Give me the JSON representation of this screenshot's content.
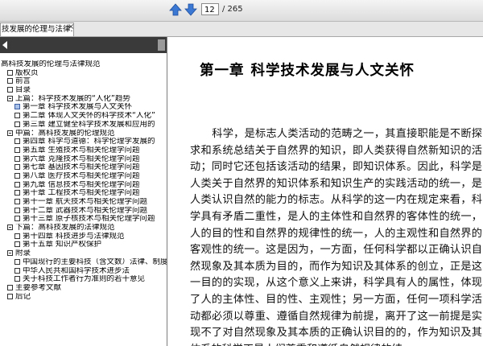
{
  "toolbar": {
    "page_current": "12",
    "page_total": "/ 265"
  },
  "tab": {
    "label": "技发展的伦理与法律...",
    "close": "×"
  },
  "sidebar": {
    "items": [
      {
        "label": "高科技发展的伦理与法律规范",
        "level": 0,
        "box": "none"
      },
      {
        "label": "版权页",
        "level": 1,
        "box": "plain"
      },
      {
        "label": "前言",
        "level": 1,
        "box": "plain"
      },
      {
        "label": "目录",
        "level": 1,
        "box": "plain"
      },
      {
        "label": "上篇：科学技术发展的“人化”趋势",
        "level": 1,
        "box": "plus"
      },
      {
        "label": "第一章  科学技术发展与人文关怀",
        "level": 2,
        "box": "sel"
      },
      {
        "label": "第二章  体现人文关怀的科学技术“人化”",
        "level": 2,
        "box": "plain"
      },
      {
        "label": "第三章  建立健全科学技术发展和应用的",
        "level": 2,
        "box": "plain"
      },
      {
        "label": "中篇：高科技发展的伦理规范",
        "level": 1,
        "box": "plus"
      },
      {
        "label": "第四章  科学与道德：科学伦理学发展的",
        "level": 2,
        "box": "plain"
      },
      {
        "label": "第五章  生殖技术与相关伦理学问题",
        "level": 2,
        "box": "plain"
      },
      {
        "label": "第六章  克隆技术与相关伦理学问题",
        "level": 2,
        "box": "plain"
      },
      {
        "label": "第七章  基因技术与相关伦理学问题",
        "level": 2,
        "box": "plain"
      },
      {
        "label": "第八章  医疗技术与相关伦理学问题",
        "level": 2,
        "box": "plain"
      },
      {
        "label": "第九章  信息技术与相关伦理学问题",
        "level": 2,
        "box": "plain"
      },
      {
        "label": "第十章  工程技术与相关伦理学问题",
        "level": 2,
        "box": "plain"
      },
      {
        "label": "第十一章  航天技术与相关伦理学问题",
        "level": 2,
        "box": "plain"
      },
      {
        "label": "第十二章  武器技术与相关伦理学问题",
        "level": 2,
        "box": "plain"
      },
      {
        "label": "第十三章  原子核技术与相关伦理学问题",
        "level": 2,
        "box": "plain"
      },
      {
        "label": "下篇：高科技发展的法律规范",
        "level": 1,
        "box": "plus"
      },
      {
        "label": "第十四章  科技进步与法律规范",
        "level": 2,
        "box": "plain"
      },
      {
        "label": "第十五章  知识产权保护",
        "level": 2,
        "box": "plain"
      },
      {
        "label": "附录",
        "level": 1,
        "box": "plus"
      },
      {
        "label": "中国现行的主要科技（含文数）法律、制度",
        "level": 2,
        "box": "plain"
      },
      {
        "label": "中华人民共和国科学技术进步法",
        "level": 2,
        "box": "plain"
      },
      {
        "label": "关于科技工作者行为准则的若干意见",
        "level": 2,
        "box": "plain"
      },
      {
        "label": "主要参考文献",
        "level": 1,
        "box": "plain"
      },
      {
        "label": "后记",
        "level": 1,
        "box": "plain"
      }
    ]
  },
  "document": {
    "chapter_num": "第一章",
    "chapter_title": "科学技术发展与人文关怀",
    "paragraph": "科学，是标志人类活动的范畴之一，其直接职能是不断探求和系统总结关于自然界的知识，即人类获得自然新知识的活动；同时它还包括该活动的结果，即知识体系。因此，科学是人类关于自然界的知识体系和知识生产的实践活动的统一，是人类认识自然的能力的标志。从科学的这一内在规定来看，科学具有矛盾二重性，是人的主体性和自然界的客体性的统一，人的目的性和自然界的规律性的统一，人的主观性和自然界的客观性的统一。这是因为，一方面，任何科学都以正确认识自然现象及其本质为目的，而作为知识及其体系的创立，正是这一目的的实现，从这个意义上来讲，科学具有人的属性，体现了人的主体性、目的性、主观性；另一方面，任何一项科学活动都必须以尊重、遵循自然规律为前提，离开了这一前提是实现不了对自然现象及其本质的正确认识目的的，作为知识及其体系的科学正是人们尊重和遵循自然规律的结"
  }
}
